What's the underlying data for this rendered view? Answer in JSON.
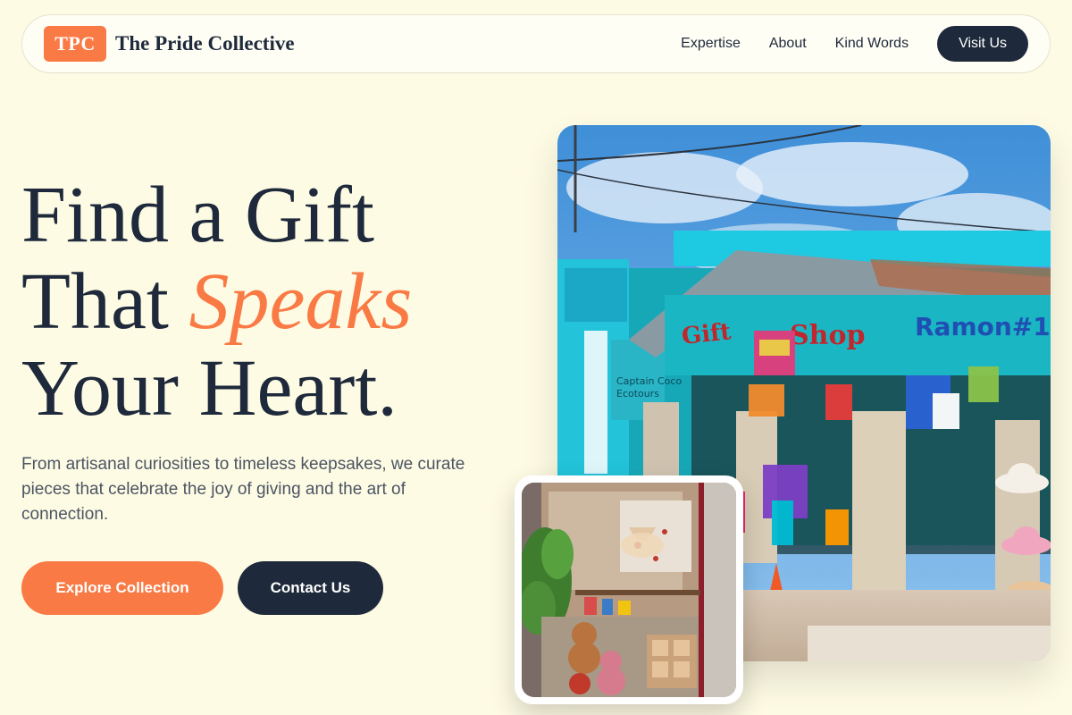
{
  "brand": {
    "badge": "TPC",
    "name": "The Pride Collective"
  },
  "nav": {
    "links": [
      "Expertise",
      "About",
      "Kind Words"
    ],
    "cta": "Visit Us"
  },
  "hero": {
    "title_line1": "Find a Gift",
    "title_line2_plain": "That ",
    "title_line2_accent": "Speaks",
    "title_line3": "Your Heart.",
    "subtitle": "From artisanal curiosities to timeless keepsakes, we curate pieces that celebrate the joy of giving and the art of connection.",
    "primary_button": "Explore Collection",
    "secondary_button": "Contact Us"
  },
  "images": {
    "main_shop_signs": [
      "Gift Shop",
      "Ramon#1",
      "Captain Coco Ecotours"
    ],
    "main_alt": "colorful-gift-shop-storefront-photo",
    "sub_alt": "shop-window-display-photo"
  },
  "colors": {
    "accent": "#f97a45",
    "dark": "#1e2a3b",
    "background": "#fefbe4"
  }
}
